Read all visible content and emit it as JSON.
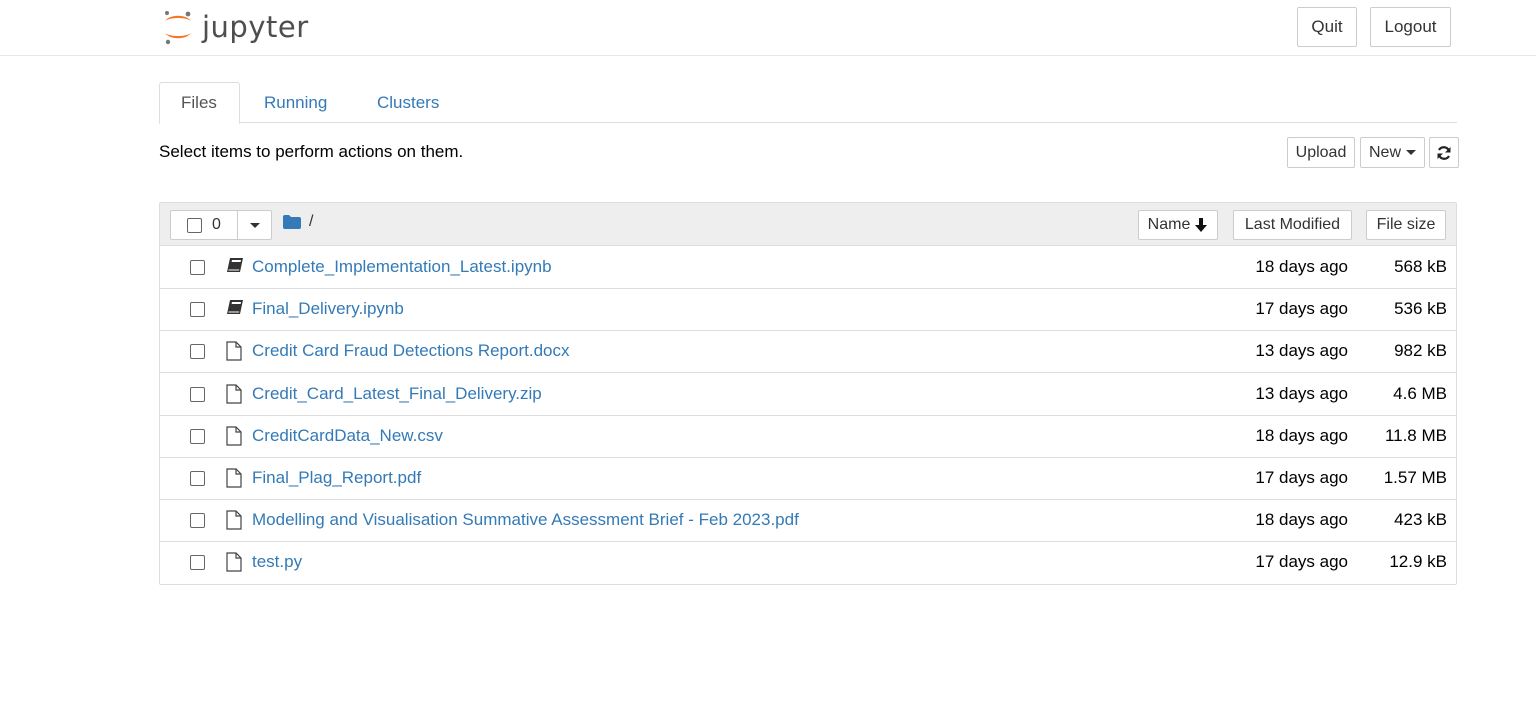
{
  "header": {
    "logo_text": "jupyter",
    "quit_label": "Quit",
    "logout_label": "Logout"
  },
  "tabs": [
    {
      "label": "Files",
      "active": true
    },
    {
      "label": "Running",
      "active": false
    },
    {
      "label": "Clusters",
      "active": false
    }
  ],
  "toolbar": {
    "instruction": "Select items to perform actions on them.",
    "upload_label": "Upload",
    "new_label": "New",
    "refresh_icon": "refresh-icon"
  },
  "list_header": {
    "selected_count": "0",
    "breadcrumb": "/",
    "name_label": "Name",
    "last_modified_label": "Last Modified",
    "file_size_label": "File size"
  },
  "files": [
    {
      "name": "Complete_Implementation_Latest.ipynb",
      "modified": "18 days ago",
      "size": "568 kB",
      "icon": "notebook-icon"
    },
    {
      "name": "Final_Delivery.ipynb",
      "modified": "17 days ago",
      "size": "536 kB",
      "icon": "notebook-icon"
    },
    {
      "name": "Credit Card Fraud Detections Report.docx",
      "modified": "13 days ago",
      "size": "982 kB",
      "icon": "file-icon"
    },
    {
      "name": "Credit_Card_Latest_Final_Delivery.zip",
      "modified": "13 days ago",
      "size": "4.6 MB",
      "icon": "file-icon"
    },
    {
      "name": "CreditCardData_New.csv",
      "modified": "18 days ago",
      "size": "11.8 MB",
      "icon": "file-icon"
    },
    {
      "name": "Final_Plag_Report.pdf",
      "modified": "17 days ago",
      "size": "1.57 MB",
      "icon": "file-icon"
    },
    {
      "name": "Modelling and Visualisation Summative Assessment Brief - Feb 2023.pdf",
      "modified": "18 days ago",
      "size": "423 kB",
      "icon": "file-icon"
    },
    {
      "name": "test.py",
      "modified": "17 days ago",
      "size": "12.9 kB",
      "icon": "file-icon"
    }
  ],
  "colors": {
    "link": "#337ab7",
    "logo_orange": "#F37726"
  }
}
